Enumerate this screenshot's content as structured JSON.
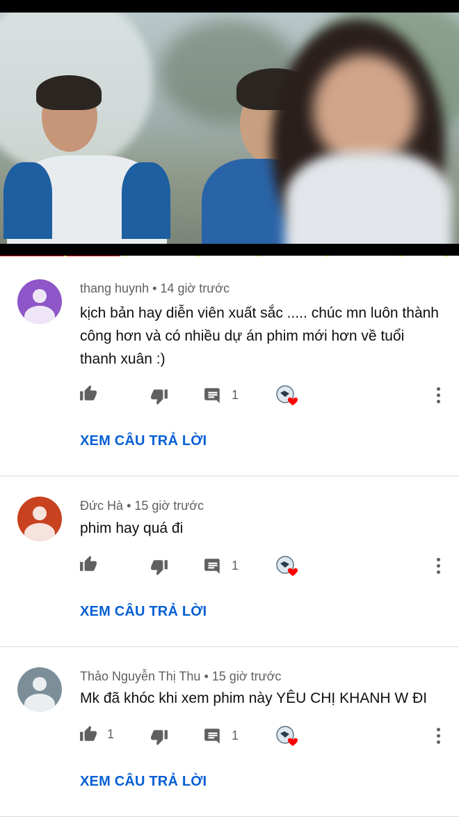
{
  "video": {
    "progress_fraction": 0.26,
    "chapter_markers": [
      0.14,
      0.27,
      0.43,
      0.56,
      0.71,
      0.87,
      0.97
    ]
  },
  "colors": {
    "link_blue": "#065fd4",
    "meta_gray": "#606060",
    "progress_red": "#e01b1b",
    "heart_red": "#ff0000"
  },
  "comments": [
    {
      "author": "thang huynh",
      "time": "14 giờ trước",
      "text": "kịch bản hay diễn viên xuất sắc ..... chúc mn luôn thành công hơn và có nhiều dự án phim mới hơn về tuổi thanh xuân :)",
      "avatar_color": "#8e56c8",
      "like_count": "",
      "reply_count": "1",
      "view_replies_label": "XEM CÂU TRẢ LỜI"
    },
    {
      "author": "Đức Hà",
      "time": "15 giờ trước",
      "text": "phim hay quá đi",
      "avatar_color": "#c8421f",
      "like_count": "",
      "reply_count": "1",
      "view_replies_label": "XEM CÂU TRẢ LỜI"
    },
    {
      "author": "Thảo Nguyễn Thị Thu",
      "time": "15 giờ trước",
      "text": "Mk đã khóc khi xem phim này YÊU CHỊ KHANH W ĐI",
      "avatar_color": "#7c8f99",
      "like_count": "1",
      "reply_count": "1",
      "view_replies_label": "XEM CÂU TRẢ LỜI"
    }
  ]
}
